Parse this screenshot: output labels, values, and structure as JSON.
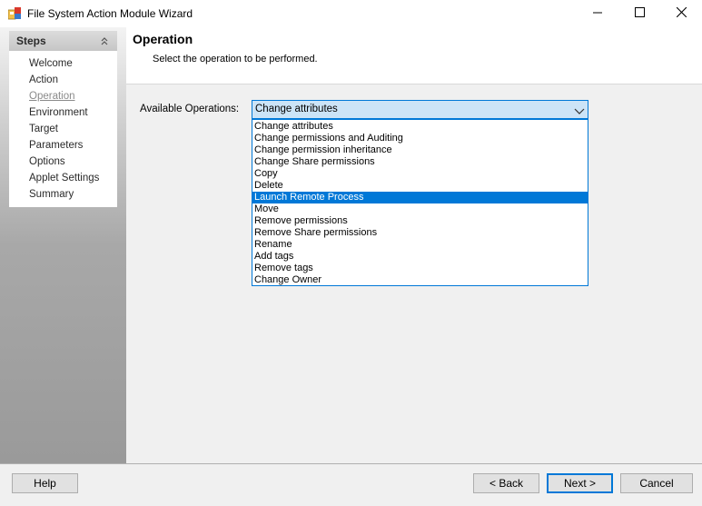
{
  "window": {
    "title": "File System Action Module Wizard",
    "app_icon": "wizard-app-icon",
    "controls": [
      "minimize-icon",
      "maximize-icon",
      "close-icon"
    ]
  },
  "steps": {
    "title": "Steps",
    "collapse_icon": "chevron-double-up-icon",
    "items": [
      {
        "label": "Welcome"
      },
      {
        "label": "Action"
      },
      {
        "label": "Operation",
        "current": true
      },
      {
        "label": "Environment"
      },
      {
        "label": "Target"
      },
      {
        "label": "Parameters"
      },
      {
        "label": "Options"
      },
      {
        "label": "Applet Settings"
      },
      {
        "label": "Summary"
      }
    ]
  },
  "header": {
    "title": "Operation",
    "subtitle": "Select the operation to be performed."
  },
  "operation": {
    "label": "Available Operations:",
    "selected_value": "Change attributes",
    "highlighted_option": "Launch Remote Process",
    "options": [
      "Change attributes",
      "Change permissions and Auditing",
      "Change permission inheritance",
      "Change Share permissions",
      "Copy",
      "Delete",
      "Launch Remote Process",
      "Move",
      "Remove permissions",
      "Remove Share permissions",
      "Rename",
      "Add tags",
      "Remove tags",
      "Change Owner"
    ]
  },
  "footer": {
    "help_label": "Help",
    "back_label": "< Back",
    "next_label": "Next >",
    "cancel_label": "Cancel"
  },
  "colors": {
    "accent": "#0078d7",
    "combo_bg": "#cce4f7",
    "dialog_bg": "#f0f0f0"
  }
}
